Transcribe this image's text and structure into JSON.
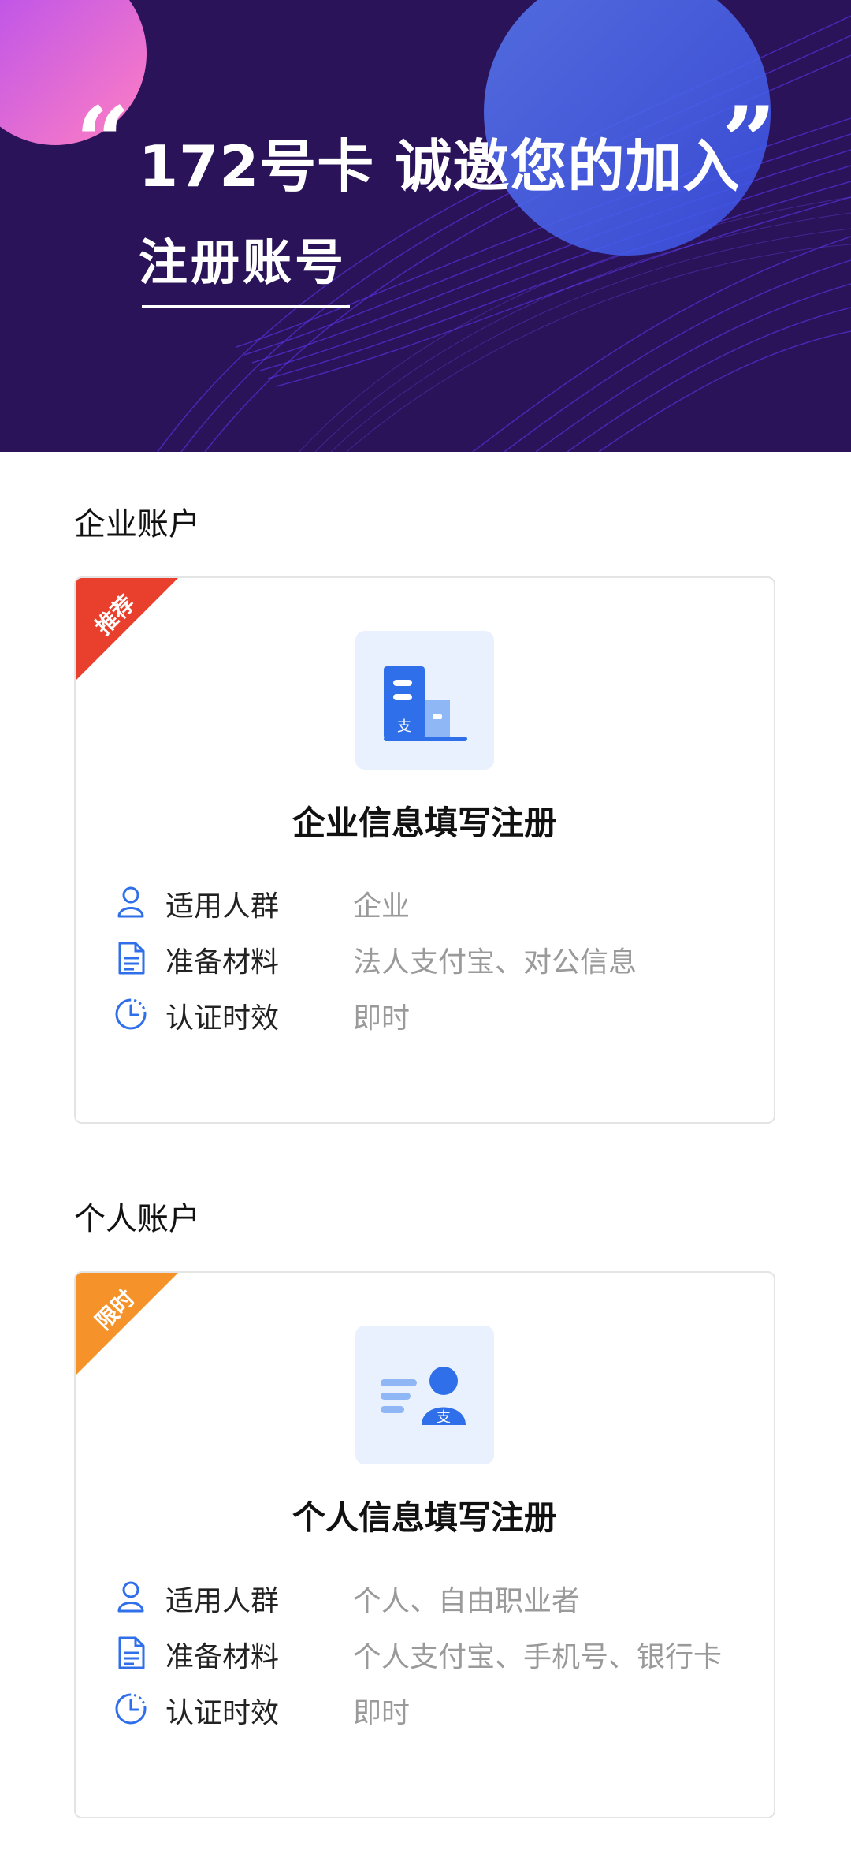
{
  "hero": {
    "quote_open": "“",
    "quote_close": "”",
    "title": "172号卡 诚邀您的加入",
    "subtitle": "注册账号"
  },
  "colors": {
    "hero_bg": "#2b1359",
    "accent_blue": "#2f6fea",
    "icon_bg": "#e8f1fd",
    "ribbon_red": "#e8402d",
    "ribbon_orange": "#f5922a",
    "muted_text": "#9a9a9a"
  },
  "sections": [
    {
      "heading": "企业账户",
      "badge": "推荐",
      "icon": "enterprise-building-icon",
      "card_title": "企业信息填写注册",
      "rows": [
        {
          "icon": "user-icon",
          "label": "适用人群",
          "value": "企业"
        },
        {
          "icon": "document-icon",
          "label": "准备材料",
          "value": "法人支付宝、对公信息"
        },
        {
          "icon": "clock-icon",
          "label": "认证时效",
          "value": "即时"
        }
      ]
    },
    {
      "heading": "个人账户",
      "badge": "限时",
      "icon": "personal-id-icon",
      "card_title": "个人信息填写注册",
      "rows": [
        {
          "icon": "user-icon",
          "label": "适用人群",
          "value": "个人、自由职业者"
        },
        {
          "icon": "document-icon",
          "label": "准备材料",
          "value": "个人支付宝、手机号、银行卡"
        },
        {
          "icon": "clock-icon",
          "label": "认证时效",
          "value": "即时"
        }
      ]
    }
  ]
}
